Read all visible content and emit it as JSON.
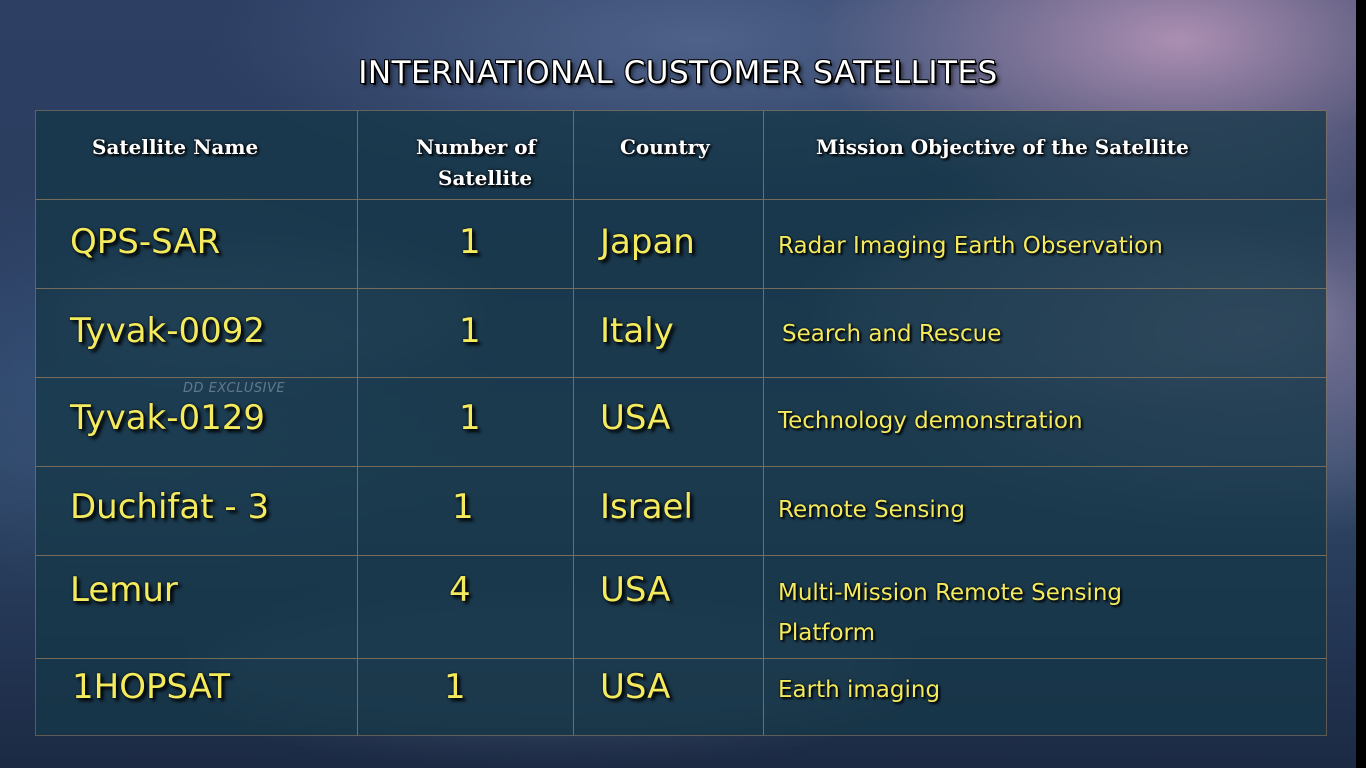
{
  "title": "INTERNATIONAL CUSTOMER SATELLITES",
  "watermark": "DD EXCLUSIVE",
  "table": {
    "headers": {
      "name": "Satellite Name",
      "number_line1": "Number of",
      "number_line2": "Satellite",
      "country": "Country",
      "mission": "Mission Objective of  the Satellite"
    },
    "rows": [
      {
        "name": "QPS-SAR",
        "number": "1",
        "country": "Japan",
        "mission_line1": "Radar Imaging Earth Observation",
        "mission_line2": ""
      },
      {
        "name": "Tyvak-0092",
        "number": "1",
        "country": "Italy",
        "mission_line1": "Search and Rescue",
        "mission_line2": ""
      },
      {
        "name": "Tyvak-0129",
        "number": "1",
        "country": "USA",
        "mission_line1": "Technology demonstration",
        "mission_line2": ""
      },
      {
        "name": "Duchifat - 3",
        "number": "1",
        "country": "Israel",
        "mission_line1": "Remote Sensing",
        "mission_line2": ""
      },
      {
        "name": "Lemur",
        "number": "4",
        "country": "USA",
        "mission_line1": "Multi-Mission Remote Sensing",
        "mission_line2": "Platform"
      },
      {
        "name": "1HOPSAT",
        "number": "1",
        "country": "USA",
        "mission_line1": "Earth imaging",
        "mission_line2": ""
      }
    ]
  },
  "colors": {
    "text_yellow": "#f3ea5e",
    "header_white": "#ffffff",
    "table_bg": "#163748"
  }
}
